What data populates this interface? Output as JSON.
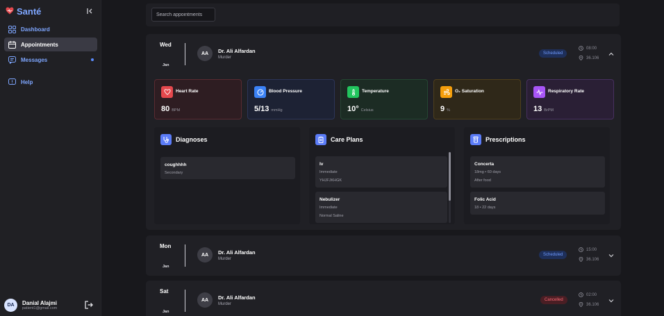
{
  "app": {
    "brand": "Santé"
  },
  "sidebar": {
    "items": [
      {
        "label": "Dashboard",
        "icon": "dashboard-icon"
      },
      {
        "label": "Appointments",
        "icon": "calendar-icon"
      },
      {
        "label": "Messages",
        "icon": "message-icon"
      },
      {
        "label": "Help",
        "icon": "help-icon"
      }
    ],
    "user": {
      "initials": "DA",
      "name": "Danial Alajmi",
      "email": "patient1@gmail.com"
    }
  },
  "search": {
    "placeholder": "Search appointments"
  },
  "appointments": [
    {
      "day": "Wed",
      "month": "Jan",
      "doctor_initials": "AA",
      "doctor": "Dr. Ali Alfardan",
      "specialty": "Murder",
      "status": "Scheduled",
      "time": "08:00",
      "location": "36.106",
      "vitals": [
        {
          "label": "Heart Rate",
          "value": "80",
          "unit": "BPM",
          "icon": "heart-icon",
          "color": "#e5484d"
        },
        {
          "label": "Blood Pressure",
          "value": "5/13",
          "unit": "mmHg",
          "icon": "gauge-icon",
          "color": "#3b82f6"
        },
        {
          "label": "Temperature",
          "value": "10°",
          "unit": "Celsius",
          "icon": "thermometer-icon",
          "color": "#22c55e"
        },
        {
          "label": "O₂ Saturation",
          "value": "9",
          "unit": "%",
          "icon": "wind-icon",
          "color": "#f59e0b"
        },
        {
          "label": "Respiratory Rate",
          "value": "13",
          "unit": "BrPM",
          "icon": "activity-icon",
          "color": "#a855f7"
        }
      ],
      "diagnoses": {
        "title": "Diagnoses",
        "items": [
          {
            "name": "coughhhh",
            "type": "Secondary"
          }
        ]
      },
      "care_plans": {
        "title": "Care Plans",
        "items": [
          {
            "name": "Iv",
            "priority": "Immediate",
            "note": "YHJFJKHGK"
          },
          {
            "name": "Nebulizer",
            "priority": "Immediate",
            "note": "Normal Saline"
          }
        ]
      },
      "prescriptions": {
        "title": "Prescriptions",
        "items": [
          {
            "name": "Concerta",
            "dosage": "18mg • 60 days",
            "note": "After food"
          },
          {
            "name": "Folic Acid",
            "dosage": "18 • 22 days",
            "note": ""
          }
        ]
      }
    },
    {
      "day": "Mon",
      "month": "Jan",
      "doctor_initials": "AA",
      "doctor": "Dr. Ali Alfardan",
      "specialty": "Murder",
      "status": "Scheduled",
      "time": "15:00",
      "location": "36.106"
    },
    {
      "day": "Sat",
      "month": "Jan",
      "doctor_initials": "AA",
      "doctor": "Dr. Ali Alfardan",
      "specialty": "Murder",
      "status": "Cancelled",
      "time": "02:00",
      "location": "36.106"
    }
  ],
  "colors": {
    "accent": "#7ea6ff",
    "scheduled": "#6f9bff",
    "cancelled": "#ff6b75"
  }
}
